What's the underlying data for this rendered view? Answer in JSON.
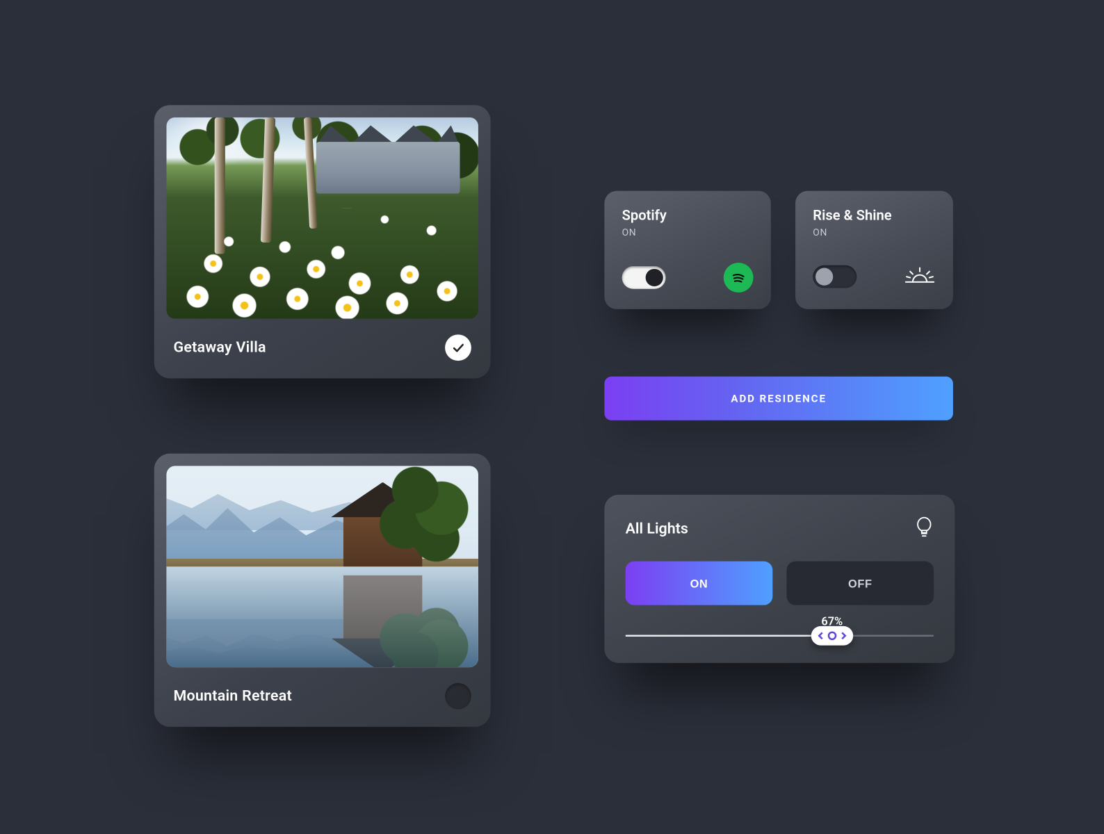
{
  "residences": [
    {
      "title": "Getaway Villa",
      "selected": true
    },
    {
      "title": "Mountain Retreat",
      "selected": false
    }
  ],
  "quick_toggles": {
    "spotify": {
      "title": "Spotify",
      "status": "ON",
      "on": true
    },
    "rise": {
      "title": "Rise & Shine",
      "status": "ON",
      "on": false
    }
  },
  "add_button": "ADD RESIDENCE",
  "lights": {
    "title": "All Lights",
    "on_label": "ON",
    "off_label": "OFF",
    "active": "on",
    "level_percent": 67,
    "level_display": "67%"
  },
  "colors": {
    "gradient_start": "#7b3ff2",
    "gradient_end": "#4fa0ff",
    "spotify_green": "#1DB954"
  }
}
